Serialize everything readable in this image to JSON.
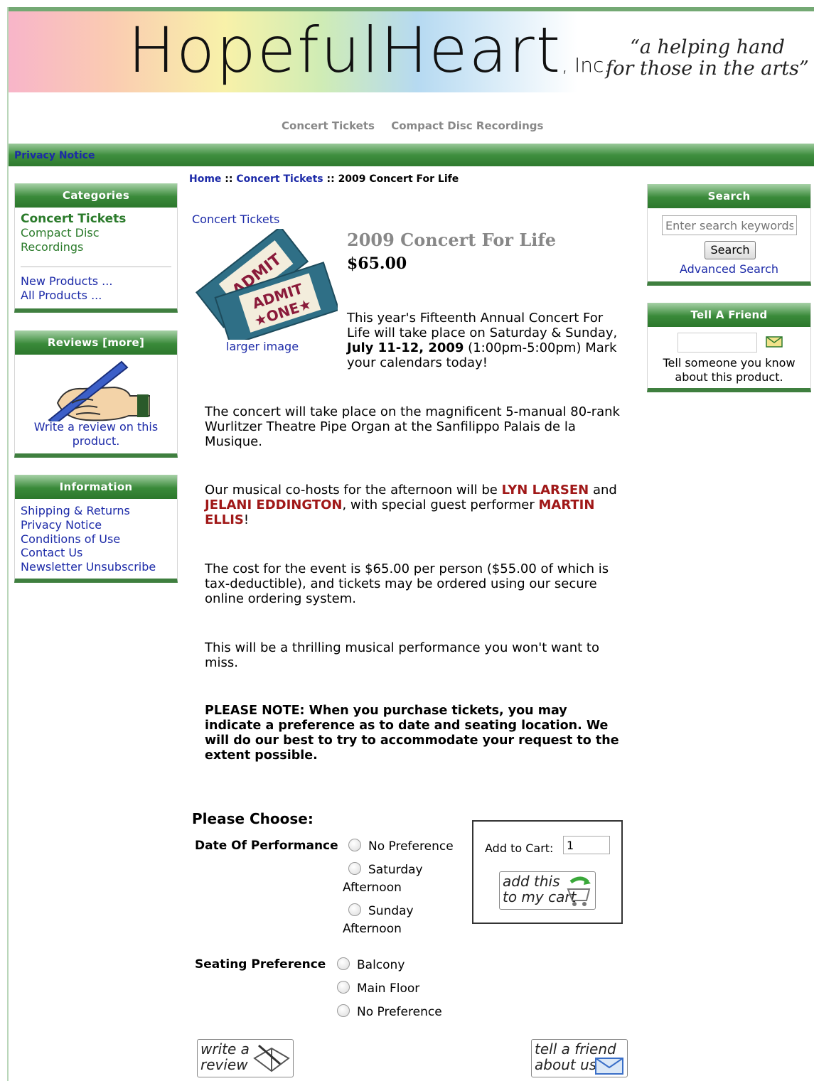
{
  "header": {
    "logo_text": "HopefulHeart",
    "logo_suffix": ", Inc.",
    "tagline_line1": "“a helping hand",
    "tagline_line2": "for those in the arts”",
    "nav": [
      "Concert Tickets",
      "Compact Disc Recordings"
    ]
  },
  "greenbar": {
    "privacy_link": "Privacy Notice"
  },
  "breadcrumb": {
    "home": "Home",
    "sep": "::",
    "category": "Concert Tickets",
    "current": "2009 Concert For Life"
  },
  "categories": {
    "title": "Categories",
    "item_active": "Concert Tickets",
    "item_cd_line1": "Compact Disc",
    "item_cd_line2": "Recordings",
    "new_products": "New Products ...",
    "all_products": "All Products ..."
  },
  "reviews_box": {
    "title": "Reviews",
    "more": "[more]",
    "write_line1": "Write a review on this",
    "write_line2": "product."
  },
  "information": {
    "title": "Information",
    "items": [
      "Shipping & Returns",
      "Privacy Notice",
      "Conditions of Use",
      "Contact Us",
      "Newsletter Unsubscribe"
    ]
  },
  "product": {
    "category_link": "Concert Tickets",
    "ticket_top": "ADMIT",
    "ticket_main1": "ADMIT",
    "ticket_main2": "★ONE★",
    "larger_image": "larger image",
    "name": "2009 Concert For Life",
    "price": "$65.00",
    "desc1_pre": "This year's Fifteenth Annual Concert For Life will take place on Saturday & Sunday, ",
    "desc1_bold": "July 11-12, 2009",
    "desc1_post": " (1:00pm-5:00pm)  Mark your calendars today!",
    "desc2": "The concert will take place on the magnificent 5-manual 80-rank Wurlitzer Theatre Pipe Organ at the Sanfilippo Palais de la Musique.",
    "desc3_a": "Our musical co-hosts for the afternoon will be ",
    "host1": "LYN LARSEN",
    "desc3_b": " and ",
    "host2": "JELANI EDDINGTON",
    "desc3_c": ", with special guest performer ",
    "guest": "MARTIN ELLIS",
    "desc3_d": "!",
    "desc4": "The cost for the event is $65.00 per person ($55.00 of which is tax-deductible), and tickets may be ordered using our secure online ordering system.",
    "desc5": "This will be a thrilling musical performance you won't want to miss.",
    "note": "PLEASE NOTE: When you purchase tickets, you may indicate a preference as to date and seating location.  We will do our best to try to accommodate your request to the extent possible."
  },
  "options": {
    "heading": "Please Choose:",
    "date_label": "Date Of Performance",
    "date_opt1": "No Preference",
    "date_opt2_a": "Saturday",
    "date_opt2_b": "Afternoon",
    "date_opt3_a": "Sunday",
    "date_opt3_b": "Afternoon",
    "seat_label": "Seating Preference",
    "seat_opt1": "Balcony",
    "seat_opt2": "Main Floor",
    "seat_opt3": "No Preference"
  },
  "cart": {
    "label": "Add to Cart:",
    "qty": "1",
    "button_line1": "add this",
    "button_line2": "to my cart"
  },
  "buttons": {
    "review_line1": "write a",
    "review_line2": "review",
    "tell_line1": "tell a friend",
    "tell_line2": "about us"
  },
  "search": {
    "title": "Search",
    "placeholder": "Enter search keywords here",
    "button": "Search",
    "advanced": "Advanced Search"
  },
  "tellfriend": {
    "title": "Tell A Friend",
    "text_line1": "Tell someone you know",
    "text_line2": "about this product."
  },
  "colors": {
    "green": "#3a8a3a",
    "link_blue": "#1c2aa8",
    "link_green": "#2b7b2b",
    "accent_red": "#a01818"
  },
  "icons": [
    "ticket-image",
    "pen-hand-icon",
    "envelope-icon",
    "cart-icon",
    "book-icon"
  ]
}
